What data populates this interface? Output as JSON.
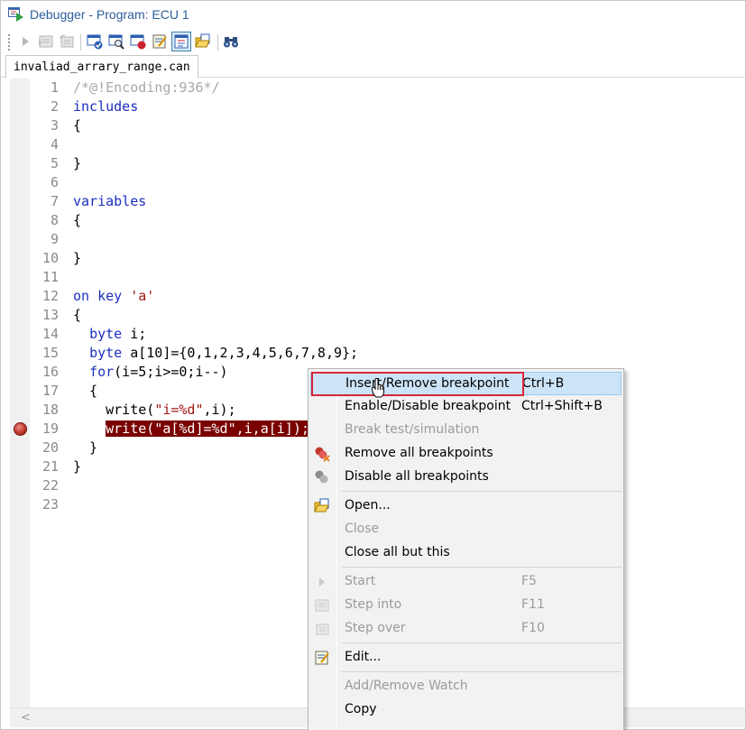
{
  "window": {
    "title": "Debugger - Program: ECU 1"
  },
  "toolbar": {
    "buttons": [
      {
        "icon": "run-icon",
        "enabled": false
      },
      {
        "icon": "step-into-icon",
        "enabled": false
      },
      {
        "icon": "step-over-icon",
        "enabled": false
      },
      {
        "icon": "check-program-icon",
        "enabled": true
      },
      {
        "icon": "inspect-icon",
        "enabled": true
      },
      {
        "icon": "stop-breakpoint-icon",
        "enabled": true
      },
      {
        "icon": "edit-icon",
        "enabled": true
      },
      {
        "icon": "view-toggle-icon",
        "enabled": true,
        "pressed": true
      },
      {
        "icon": "open-folder-icon",
        "enabled": true
      },
      {
        "icon": "find-binoculars-icon",
        "enabled": true
      }
    ]
  },
  "tab": {
    "label": "invaliad_arrary_range.can"
  },
  "editor": {
    "lines": [
      {
        "n": "1",
        "parts": [
          {
            "t": "/*@!Encoding:936*/",
            "c": "comment"
          }
        ]
      },
      {
        "n": "2",
        "parts": [
          {
            "t": "includes",
            "c": "kw"
          }
        ]
      },
      {
        "n": "3",
        "parts": [
          {
            "t": "{",
            "c": ""
          }
        ]
      },
      {
        "n": "4",
        "parts": []
      },
      {
        "n": "5",
        "parts": [
          {
            "t": "}",
            "c": ""
          }
        ]
      },
      {
        "n": "6",
        "parts": []
      },
      {
        "n": "7",
        "parts": [
          {
            "t": "variables",
            "c": "kw"
          }
        ]
      },
      {
        "n": "8",
        "parts": [
          {
            "t": "{",
            "c": ""
          }
        ]
      },
      {
        "n": "9",
        "parts": []
      },
      {
        "n": "10",
        "parts": [
          {
            "t": "}",
            "c": ""
          }
        ]
      },
      {
        "n": "11",
        "parts": []
      },
      {
        "n": "12",
        "parts": [
          {
            "t": "on key ",
            "c": "kw"
          },
          {
            "t": "'a'",
            "c": "str"
          }
        ]
      },
      {
        "n": "13",
        "parts": [
          {
            "t": "{",
            "c": ""
          }
        ]
      },
      {
        "n": "14",
        "parts": [
          {
            "t": "  ",
            "c": ""
          },
          {
            "t": "byte",
            "c": "kw"
          },
          {
            "t": " i;",
            "c": ""
          }
        ]
      },
      {
        "n": "15",
        "parts": [
          {
            "t": "  ",
            "c": ""
          },
          {
            "t": "byte",
            "c": "kw"
          },
          {
            "t": " a[10]={0,1,2,3,4,5,6,7,8,9};",
            "c": ""
          }
        ]
      },
      {
        "n": "16",
        "parts": [
          {
            "t": "  ",
            "c": ""
          },
          {
            "t": "for",
            "c": "kw"
          },
          {
            "t": "(i=5;i>=0;i--)",
            "c": ""
          }
        ]
      },
      {
        "n": "17",
        "parts": [
          {
            "t": "  {",
            "c": ""
          }
        ]
      },
      {
        "n": "18",
        "parts": [
          {
            "t": "    write(",
            "c": ""
          },
          {
            "t": "\"i=%d\"",
            "c": "str"
          },
          {
            "t": ",i);",
            "c": ""
          }
        ]
      },
      {
        "n": "19",
        "breakpoint": true,
        "parts": [
          {
            "t": "    ",
            "c": ""
          },
          {
            "t": "write(\"a[%d]=%d\",i,a[i]);",
            "c": "hl"
          }
        ]
      },
      {
        "n": "20",
        "parts": [
          {
            "t": "  }",
            "c": ""
          }
        ]
      },
      {
        "n": "21",
        "parts": [
          {
            "t": "}",
            "c": ""
          }
        ]
      },
      {
        "n": "22",
        "parts": []
      },
      {
        "n": "23",
        "parts": []
      }
    ]
  },
  "context_menu": {
    "items": [
      {
        "label": "Insert/Remove breakpoint",
        "shortcut": "Ctrl+B",
        "enabled": true,
        "highlighted": true
      },
      {
        "label": "Enable/Disable breakpoint",
        "shortcut": "Ctrl+Shift+B",
        "enabled": true
      },
      {
        "label": "Break test/simulation",
        "shortcut": "",
        "enabled": false
      },
      {
        "label": "Remove all breakpoints",
        "shortcut": "",
        "enabled": true,
        "icon": "remove-breakpoints-icon"
      },
      {
        "label": "Disable all breakpoints",
        "shortcut": "",
        "enabled": true,
        "icon": "disable-breakpoints-icon"
      },
      {
        "separator": true
      },
      {
        "label": "Open...",
        "shortcut": "",
        "enabled": true,
        "icon": "open-folder-icon"
      },
      {
        "label": "Close",
        "shortcut": "",
        "enabled": false
      },
      {
        "label": "Close all but this",
        "shortcut": "",
        "enabled": true
      },
      {
        "separator": true
      },
      {
        "label": "Start",
        "shortcut": "F5",
        "enabled": false,
        "icon": "run-icon"
      },
      {
        "label": "Step into",
        "shortcut": "F11",
        "enabled": false,
        "icon": "step-into-icon"
      },
      {
        "label": "Step over",
        "shortcut": "F10",
        "enabled": false,
        "icon": "step-over-icon"
      },
      {
        "separator": true
      },
      {
        "label": "Edit...",
        "shortcut": "",
        "enabled": true,
        "icon": "edit-icon"
      },
      {
        "separator": true
      },
      {
        "label": "Add/Remove Watch",
        "shortcut": "",
        "enabled": false
      },
      {
        "label": "Copy",
        "shortcut": "",
        "enabled": true
      }
    ]
  },
  "colors": {
    "title": "#2d5c9b",
    "keyword": "#1b2fbf",
    "string": "#a31515",
    "comment": "#a8a8a8",
    "current_line_bg": "#7a0000",
    "menu_highlight": "#cce4f7",
    "focus_outline": "#d9263b"
  }
}
